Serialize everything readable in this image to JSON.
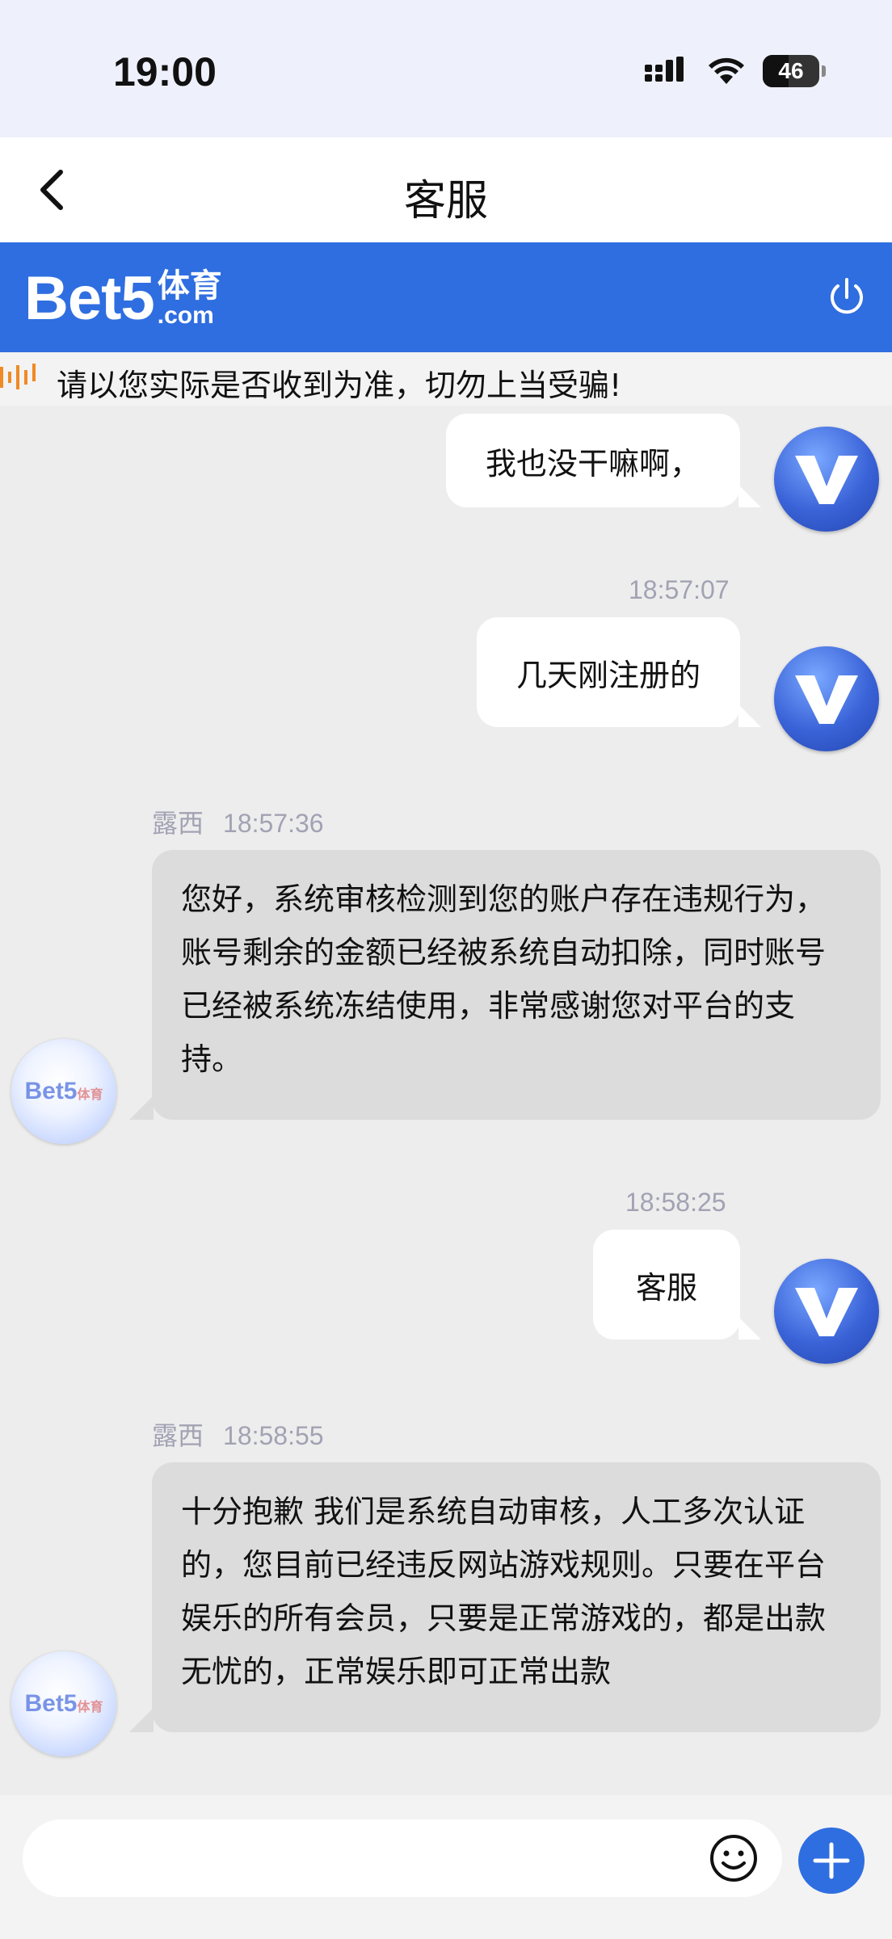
{
  "status_bar": {
    "time": "19:00",
    "battery": "46"
  },
  "nav": {
    "title": "客服"
  },
  "brand": {
    "logo_main": "Bet5",
    "logo_cn": "体育",
    "logo_com": ".com"
  },
  "notice": {
    "text": "请以您实际是否收到为准，切勿上当受骗!"
  },
  "messages": {
    "m1": {
      "text": "我也没干嘛啊，"
    },
    "m2": {
      "time": "18:57:07",
      "text": "几天刚注册的"
    },
    "m3": {
      "sender": "露西",
      "time": "18:57:36",
      "text": "您好，系统审核检测到您的账户存在违规行为，账号剩余的金额已经被系统自动扣除，同时账号已经被系统冻结使用，非常感谢您对平台的支持。"
    },
    "m4": {
      "time": "18:58:25",
      "text": "客服"
    },
    "m5": {
      "sender": "露西",
      "time": "18:58:55",
      "text": "十分抱歉 我们是系统自动审核，人工多次认证的，您目前已经违反网站游戏规则。只要在平台娱乐的所有会员，只要是正常游戏的，都是出款无忧的，正常娱乐即可正常出款"
    }
  },
  "agent_avatar": {
    "logo": "Bet5",
    "logo_cn": "体育"
  },
  "input": {
    "placeholder": ""
  },
  "icons": {
    "back": "chevron-left-icon",
    "power": "power-icon",
    "notice": "sound-wave-icon",
    "signal": "cellular-signal-icon",
    "wifi": "wifi-icon",
    "battery": "battery-icon",
    "emoji": "smiley-icon",
    "plus": "plus-icon",
    "user_avatar": "v-logo-avatar"
  },
  "colors": {
    "brand": "#2f6ee0",
    "incoming_bubble": "#dcdcdc",
    "outgoing_bubble": "#ffffff",
    "notice_icon": "#f08a24"
  }
}
